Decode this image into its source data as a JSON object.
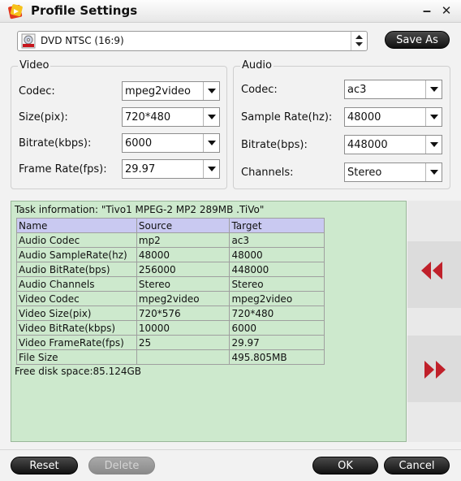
{
  "window": {
    "title": "Profile Settings",
    "minimize": "‒",
    "close": "✕"
  },
  "profile": {
    "selected": "DVD NTSC (16:9)",
    "save_as_label": "Save As"
  },
  "video": {
    "legend": "Video",
    "fields": [
      {
        "label": "Codec:",
        "value": "mpeg2video"
      },
      {
        "label": "Size(pix):",
        "value": "720*480"
      },
      {
        "label": "Bitrate(kbps):",
        "value": "6000"
      },
      {
        "label": "Frame Rate(fps):",
        "value": "29.97"
      }
    ]
  },
  "audio": {
    "legend": "Audio",
    "fields": [
      {
        "label": "Codec:",
        "value": "ac3"
      },
      {
        "label": "Sample Rate(hz):",
        "value": "48000"
      },
      {
        "label": "Bitrate(bps):",
        "value": "448000"
      },
      {
        "label": "Channels:",
        "value": "Stereo"
      }
    ]
  },
  "task": {
    "info_text": "Task information: \"Tivo1 MPEG-2 MP2 289MB .TiVo\"",
    "headers": [
      "Name",
      "Source",
      "Target"
    ],
    "rows": [
      [
        "Audio Codec",
        "mp2",
        "ac3"
      ],
      [
        "Audio SampleRate(hz)",
        "48000",
        "48000"
      ],
      [
        "Audio BitRate(bps)",
        "256000",
        "448000"
      ],
      [
        "Audio Channels",
        "Stereo",
        "Stereo"
      ],
      [
        "Video Codec",
        "mpeg2video",
        "mpeg2video"
      ],
      [
        "Video Size(pix)",
        "720*576",
        "720*480"
      ],
      [
        "Video BitRate(kbps)",
        "10000",
        "6000"
      ],
      [
        "Video FrameRate(fps)",
        "25",
        "29.97"
      ],
      [
        "File Size",
        "",
        "495.805MB"
      ]
    ],
    "free_disk": "Free disk space:85.124GB"
  },
  "footer": {
    "reset": "Reset",
    "delete": "Delete",
    "ok": "OK",
    "cancel": "Cancel"
  },
  "icons": {
    "app": "app-logo-icon",
    "profile": "dvd-disc-icon",
    "collapse": "double-left-arrow-icon",
    "expand": "double-right-arrow-icon"
  },
  "colors": {
    "arrows": "#c0202a",
    "info_panel": "#cde9cd",
    "table_header": "#c9c9f1"
  }
}
